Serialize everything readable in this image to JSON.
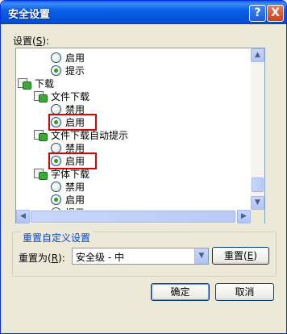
{
  "window": {
    "title": "安全设置",
    "help_button": "?",
    "close_button": "X"
  },
  "settings_label": "设置",
  "settings_hotkey": "S",
  "tree": [
    {
      "type": "radio",
      "label": "启用",
      "checked": false
    },
    {
      "type": "radio",
      "label": "提示",
      "checked": true
    },
    {
      "type": "category",
      "label": "下载"
    },
    {
      "type": "folder",
      "label": "文件下载"
    },
    {
      "type": "radio",
      "label": "禁用",
      "checked": false
    },
    {
      "type": "radio",
      "label": "启用",
      "checked": true,
      "highlighted": true
    },
    {
      "type": "folder",
      "label": "文件下载自动提示"
    },
    {
      "type": "radio",
      "label": "禁用",
      "checked": false
    },
    {
      "type": "radio",
      "label": "启用",
      "checked": true,
      "highlighted": true
    },
    {
      "type": "folder",
      "label": "字体下载"
    },
    {
      "type": "radio",
      "label": "禁用",
      "checked": false
    },
    {
      "type": "radio",
      "label": "启用",
      "checked": true
    },
    {
      "type": "radio",
      "label": "提示",
      "checked": false
    }
  ],
  "scroll_up_icon": "▲",
  "scroll_down_icon": "▼",
  "scroll_left_icon": "◀",
  "scroll_right_icon": "▶",
  "reset_group": {
    "title": "重置自定义设置",
    "reset_to_label": "重置为",
    "reset_to_hotkey": "R",
    "level_value": "安全级 - 中",
    "dropdown_icon": "▼",
    "reset_button": "重置",
    "reset_button_hotkey": "E"
  },
  "buttons": {
    "ok": "确定",
    "cancel": "取消"
  },
  "colors": {
    "titlebar": "#0A5FE8",
    "highlight": "#E00000",
    "radio_dot": "#21A121",
    "group_title": "#0046D5"
  }
}
